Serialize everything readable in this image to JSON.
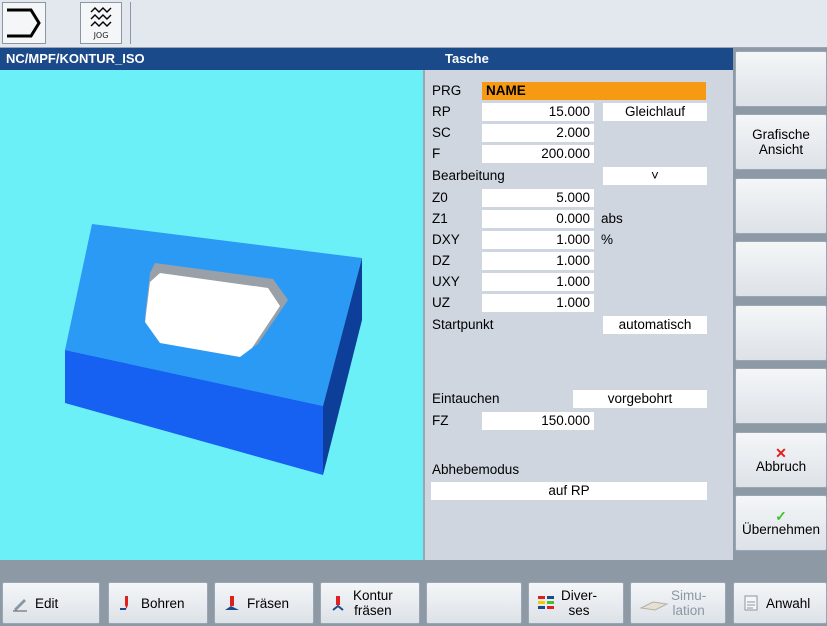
{
  "topbar": {
    "mode_label": "JOG"
  },
  "title": {
    "path": "NC/MPF/KONTUR_ISO",
    "dialog": "Tasche"
  },
  "params": {
    "prg": {
      "label": "PRG",
      "value": "NAME"
    },
    "rp": {
      "label": "RP",
      "value": "15.000",
      "option": "Gleichlauf"
    },
    "sc": {
      "label": "SC",
      "value": "2.000"
    },
    "f": {
      "label": "F",
      "value": "200.000"
    },
    "bearbeitung": {
      "label": "Bearbeitung",
      "option": "˅"
    },
    "z0": {
      "label": "Z0",
      "value": "5.000"
    },
    "z1": {
      "label": "Z1",
      "value": "0.000",
      "unit": "abs"
    },
    "dxy": {
      "label": "DXY",
      "value": "1.000",
      "unit": "%"
    },
    "dz": {
      "label": "DZ",
      "value": "1.000"
    },
    "uxy": {
      "label": "UXY",
      "value": "1.000"
    },
    "uz": {
      "label": "UZ",
      "value": "1.000"
    },
    "startpunkt": {
      "label": "Startpunkt",
      "option": "automatisch"
    },
    "eintauchen": {
      "label": "Eintauchen",
      "option": "vorgebohrt"
    },
    "fz": {
      "label": "FZ",
      "value": "150.000"
    },
    "abhebemodus": {
      "label": "Abhebemodus",
      "option": "auf RP"
    }
  },
  "vsoftkeys": {
    "grafische_1": "Grafische",
    "grafische_2": "Ansicht",
    "abbruch": "Abbruch",
    "uebernehmen": "Übernehmen"
  },
  "hsoftkeys": {
    "edit": "Edit",
    "bohren": "Bohren",
    "fraesen": "Fräsen",
    "kontur_1": "Kontur",
    "kontur_2": "fräsen",
    "divers_1": "Diver-",
    "divers_2": "ses",
    "simu_1": "Simu-",
    "simu_2": "lation",
    "anwahl": "Anwahl"
  },
  "colors": {
    "title_bg": "#1b4a8b",
    "name_field": "#f59a12",
    "graphic_bg": "#6cf0f8",
    "block_top": "#2b9af5",
    "block_front": "#1660f2",
    "block_side": "#0d3f9a",
    "abbruch_icon": "#e0201c",
    "uebernehmen_icon": "#3fc42a"
  },
  "icons": [
    "mode-arrow-icon",
    "jog-wave-icon",
    "close-x-icon",
    "checkmark-icon",
    "pencil-icon",
    "drill-icon",
    "mill-icon",
    "contour-mill-icon",
    "various-icon",
    "simulation-icon",
    "selection-icon"
  ]
}
